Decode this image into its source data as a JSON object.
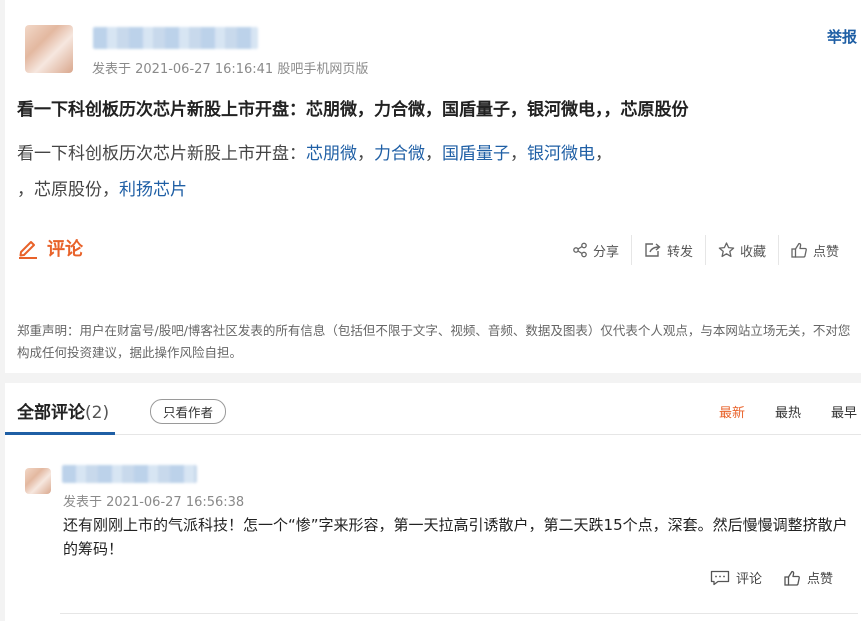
{
  "post": {
    "report_label": "举报",
    "meta": "发表于 2021-06-27 16:16:41 股吧手机网页版",
    "title": "看一下科创板历次芯片新股上市开盘：芯朋微，力合微，国盾量子，银河微电，，芯原股份",
    "body": {
      "prefix": "看一下科创板历次芯片新股上市开盘：",
      "links": [
        "芯朋微",
        "力合微",
        "国盾量子",
        "银河微电",
        "芯原股份",
        "利扬芯片"
      ],
      "sep_comma": "，",
      "line2_prefix": "，"
    },
    "comment_label": "评论",
    "actions": {
      "share": "分享",
      "forward": "转发",
      "favorite": "收藏",
      "like": "点赞"
    },
    "disclaimer": "郑重声明：用户在财富号/股吧/博客社区发表的所有信息（包括但不限于文字、视频、音频、数据及图表）仅代表个人观点，与本网站立场无关，不对您构成任何投资建议，据此操作风险自担。"
  },
  "comments_section": {
    "tab_label": "全部评论",
    "count": "(2)",
    "only_author": "只看作者",
    "sort_options": [
      "最新",
      "最热",
      "最早"
    ],
    "active_sort": "最新"
  },
  "comment": {
    "meta": "发表于 2021-06-27 16:56:38",
    "text": "还有刚刚上市的气派科技！怎一个“惨”字来形容，第一天拉高引诱散户，第二天跌15个点，深套。然后慢慢调整挤散户的筹码！",
    "reply_label": "评论",
    "like_label": "点赞"
  },
  "colors": {
    "accent_orange": "#e8622a",
    "link_blue": "#1f5fa5"
  }
}
